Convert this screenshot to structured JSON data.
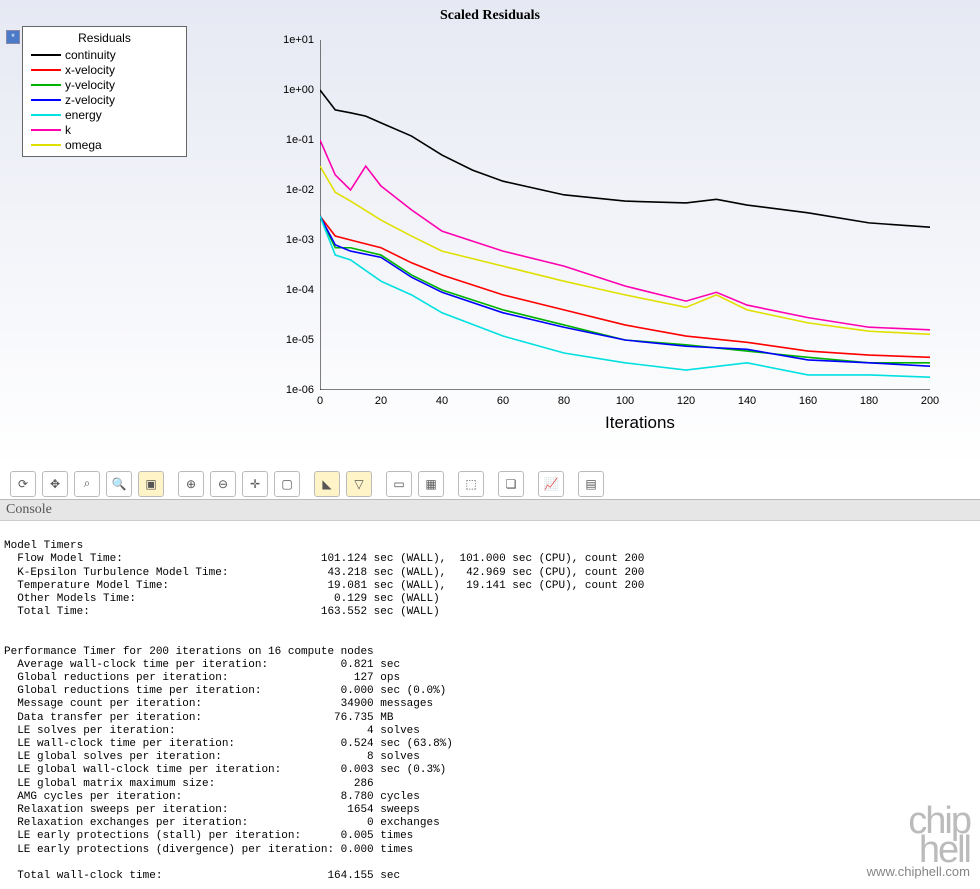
{
  "chart_data": {
    "type": "line",
    "title": "Scaled Residuals",
    "xlabel": "Iterations",
    "ylabel": "",
    "ylim": [
      1e-06,
      10.0
    ],
    "xlim": [
      0,
      200
    ],
    "y_scale": "log",
    "xticks": [
      0,
      20,
      40,
      60,
      80,
      100,
      120,
      140,
      160,
      180,
      200
    ],
    "yticks": [
      "1e-06",
      "1e-05",
      "1e-04",
      "1e-03",
      "1e-02",
      "1e-01",
      "1e+00",
      "1e+01"
    ],
    "legend_title": "Residuals",
    "series": [
      {
        "name": "continuity",
        "color": "#000000",
        "x": [
          0,
          5,
          10,
          15,
          20,
          30,
          40,
          50,
          60,
          80,
          100,
          120,
          130,
          140,
          160,
          180,
          200
        ],
        "y": [
          1.0,
          0.4,
          0.35,
          0.3,
          0.22,
          0.12,
          0.05,
          0.025,
          0.015,
          0.008,
          0.006,
          0.0055,
          0.0065,
          0.005,
          0.0035,
          0.0022,
          0.0018
        ]
      },
      {
        "name": "x-velocity",
        "color": "#ff0000",
        "x": [
          0,
          5,
          10,
          20,
          30,
          40,
          60,
          80,
          100,
          120,
          140,
          160,
          180,
          200
        ],
        "y": [
          0.003,
          0.0012,
          0.001,
          0.0007,
          0.00035,
          0.0002,
          8e-05,
          4e-05,
          2e-05,
          1.2e-05,
          9e-06,
          6e-06,
          5e-06,
          4.5e-06
        ]
      },
      {
        "name": "y-velocity",
        "color": "#00b300",
        "x": [
          0,
          5,
          10,
          20,
          30,
          40,
          60,
          80,
          100,
          120,
          140,
          160,
          180,
          200
        ],
        "y": [
          0.003,
          0.0007,
          0.0007,
          0.0005,
          0.0002,
          0.0001,
          4e-05,
          2e-05,
          1e-05,
          8e-06,
          6e-06,
          4.5e-06,
          3.5e-06,
          3.5e-06
        ]
      },
      {
        "name": "z-velocity",
        "color": "#0000ff",
        "x": [
          0,
          5,
          10,
          20,
          30,
          40,
          60,
          80,
          100,
          120,
          140,
          160,
          180,
          200
        ],
        "y": [
          0.003,
          0.0008,
          0.0006,
          0.00045,
          0.00018,
          9e-05,
          3.5e-05,
          1.8e-05,
          1e-05,
          7.5e-06,
          6.5e-06,
          4e-06,
          3.5e-06,
          3e-06
        ]
      },
      {
        "name": "energy",
        "color": "#00e0e0",
        "x": [
          0,
          5,
          10,
          20,
          30,
          40,
          60,
          80,
          100,
          120,
          140,
          160,
          180,
          200
        ],
        "y": [
          0.003,
          0.0005,
          0.0004,
          0.00015,
          8e-05,
          3.5e-05,
          1.2e-05,
          5.5e-06,
          3.5e-06,
          2.5e-06,
          3.5e-06,
          2e-06,
          2e-06,
          1.8e-06
        ]
      },
      {
        "name": "k",
        "color": "#ff00b0",
        "x": [
          0,
          5,
          10,
          15,
          20,
          30,
          40,
          60,
          80,
          100,
          120,
          130,
          140,
          160,
          180,
          200
        ],
        "y": [
          0.1,
          0.02,
          0.01,
          0.03,
          0.012,
          0.004,
          0.0015,
          0.0006,
          0.0003,
          0.00012,
          6e-05,
          9e-05,
          5e-05,
          2.8e-05,
          1.8e-05,
          1.6e-05
        ]
      },
      {
        "name": "omega",
        "color": "#e0e000",
        "x": [
          0,
          5,
          10,
          20,
          30,
          40,
          60,
          80,
          100,
          120,
          130,
          140,
          160,
          180,
          200
        ],
        "y": [
          0.03,
          0.009,
          0.006,
          0.0025,
          0.0012,
          0.0006,
          0.0003,
          0.00015,
          8e-05,
          4.5e-05,
          8e-05,
          4e-05,
          2.2e-05,
          1.5e-05,
          1.3e-05
        ]
      }
    ]
  },
  "legend": {
    "title": "Residuals",
    "items": [
      {
        "label": "continuity",
        "color": "#000000"
      },
      {
        "label": "x-velocity",
        "color": "#ff0000"
      },
      {
        "label": "y-velocity",
        "color": "#00b300"
      },
      {
        "label": "z-velocity",
        "color": "#0000ff"
      },
      {
        "label": "energy",
        "color": "#00e0e0"
      },
      {
        "label": "k",
        "color": "#ff00b0"
      },
      {
        "label": "omega",
        "color": "#e0e000"
      }
    ]
  },
  "toolbar": {
    "buttons": [
      {
        "name": "refresh-icon",
        "glyph": "⟳"
      },
      {
        "name": "move-icon",
        "glyph": "✥"
      },
      {
        "name": "zoom-select-icon",
        "glyph": "⌕"
      },
      {
        "name": "zoom-icon",
        "glyph": "🔍"
      },
      {
        "name": "zoom-box-icon",
        "glyph": "▣",
        "highlight": true
      },
      {
        "sep": true
      },
      {
        "name": "zoom-in-icon",
        "glyph": "⊕"
      },
      {
        "name": "zoom-out-icon",
        "glyph": "⊖"
      },
      {
        "name": "crosshair-icon",
        "glyph": "✛"
      },
      {
        "name": "page-icon",
        "glyph": "▢"
      },
      {
        "sep": true
      },
      {
        "name": "flag-icon",
        "glyph": "◣",
        "highlight": true
      },
      {
        "name": "funnel-icon",
        "glyph": "▽",
        "highlight": true
      },
      {
        "sep": true
      },
      {
        "name": "swatch-icon",
        "glyph": "▭"
      },
      {
        "name": "cube-color-icon",
        "glyph": "▦"
      },
      {
        "sep": true
      },
      {
        "name": "cube-icon",
        "glyph": "⬚"
      },
      {
        "sep": true
      },
      {
        "name": "overlay-icon",
        "glyph": "❏"
      },
      {
        "sep": true
      },
      {
        "name": "chart-icon",
        "glyph": "📈"
      },
      {
        "sep": true
      },
      {
        "name": "note-icon",
        "glyph": "▤"
      }
    ]
  },
  "console": {
    "header": "Console",
    "lines": [
      "",
      "Model Timers",
      "  Flow Model Time:                              101.124 sec (WALL),  101.000 sec (CPU), count 200",
      "  K-Epsilon Turbulence Model Time:               43.218 sec (WALL),   42.969 sec (CPU), count 200",
      "  Temperature Model Time:                        19.081 sec (WALL),   19.141 sec (CPU), count 200",
      "  Other Models Time:                              0.129 sec (WALL)",
      "  Total Time:                                   163.552 sec (WALL)",
      "",
      "",
      "Performance Timer for 200 iterations on 16 compute nodes",
      "  Average wall-clock time per iteration:           0.821 sec",
      "  Global reductions per iteration:                   127 ops",
      "  Global reductions time per iteration:            0.000 sec (0.0%)",
      "  Message count per iteration:                     34900 messages",
      "  Data transfer per iteration:                    76.735 MB",
      "  LE solves per iteration:                             4 solves",
      "  LE wall-clock time per iteration:                0.524 sec (63.8%)",
      "  LE global solves per iteration:                      8 solves",
      "  LE global wall-clock time per iteration:         0.003 sec (0.3%)",
      "  LE global matrix maximum size:                     286",
      "  AMG cycles per iteration:                        8.780 cycles",
      "  Relaxation sweeps per iteration:                  1654 sweeps",
      "  Relaxation exchanges per iteration:                  0 exchanges",
      "  LE early protections (stall) per iteration:      0.005 times",
      "  LE early protections (divergence) per iteration: 0.000 times",
      "",
      "  Total wall-clock time:                         164.155 sec"
    ]
  },
  "watermark": {
    "logo": "chip\nhell",
    "url": "www.chiphell.com"
  }
}
